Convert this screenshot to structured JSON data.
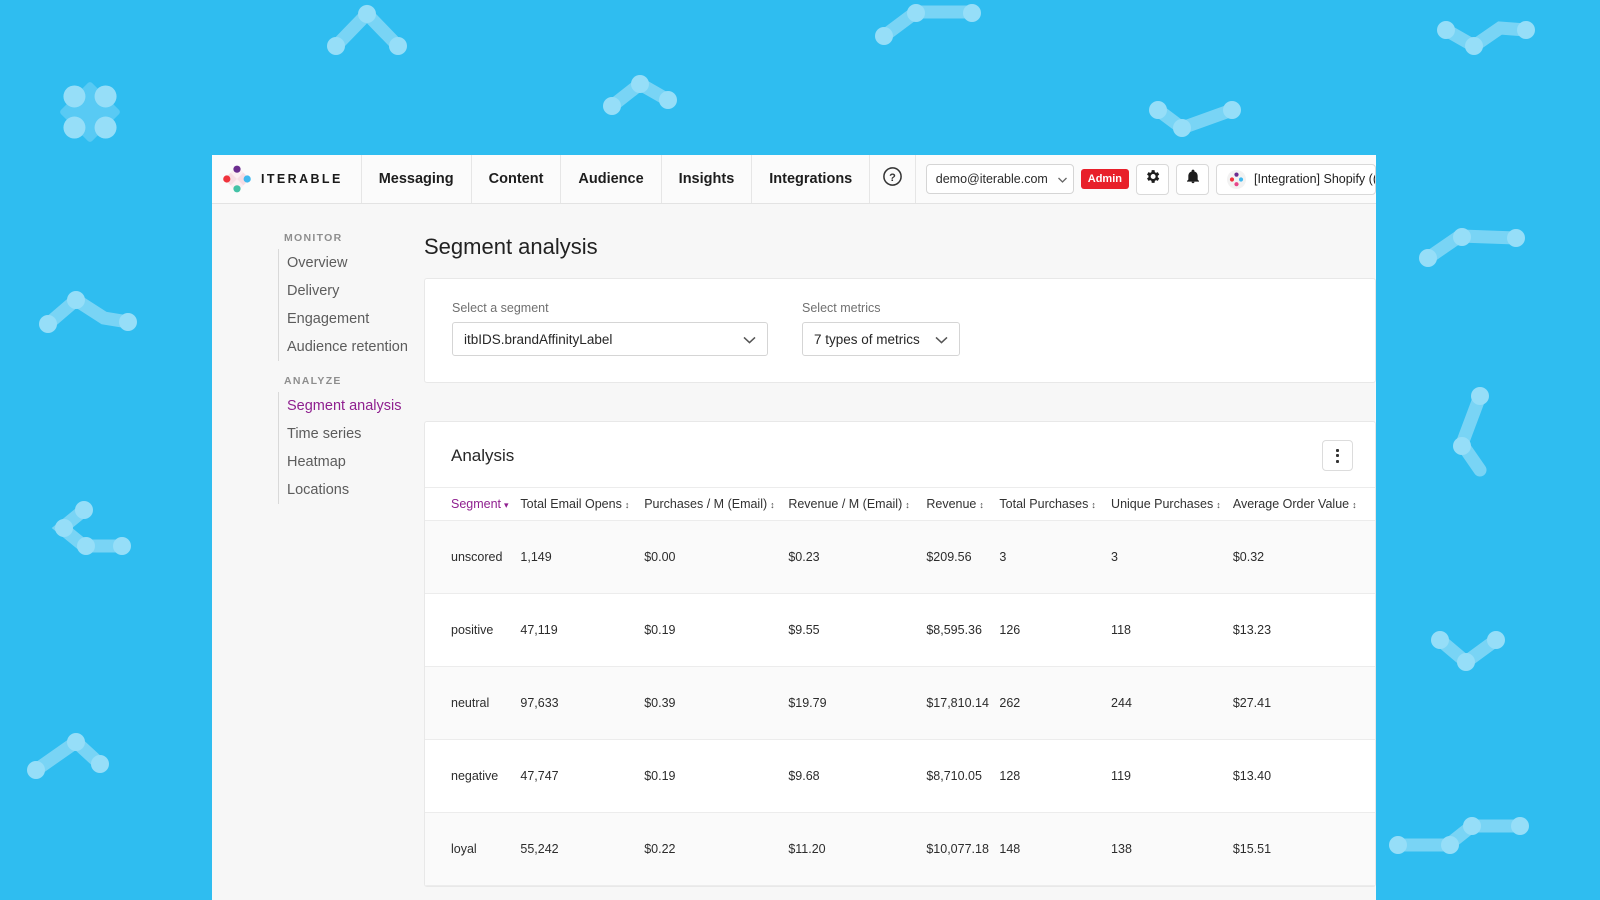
{
  "background": {
    "color": "#2fbdf0",
    "decor_color": "#87d9f7"
  },
  "topnav": {
    "brand": "ITERABLE",
    "brand_icon": "iterable-diamond-logo",
    "items": [
      {
        "label": "Messaging"
      },
      {
        "label": "Content"
      },
      {
        "label": "Audience"
      },
      {
        "label": "Insights"
      },
      {
        "label": "Integrations"
      }
    ],
    "help_icon": "question-circle-icon",
    "account": {
      "value": "demo@iterable.com",
      "caret_icon": "chevron-down-icon"
    },
    "admin_badge": "Admin",
    "admin_badge_color": "#e8202a",
    "gear_icon": "gear-icon",
    "bell_icon": "bell-icon",
    "integration": {
      "label": "[Integration] Shopify ((",
      "icon": "iterable-project-icon"
    }
  },
  "sidebar": {
    "groups": [
      {
        "label": "MONITOR",
        "items": [
          {
            "label": "Overview",
            "active": false
          },
          {
            "label": "Delivery",
            "active": false
          },
          {
            "label": "Engagement",
            "active": false
          },
          {
            "label": "Audience retention",
            "active": false
          }
        ]
      },
      {
        "label": "ANALYZE",
        "items": [
          {
            "label": "Segment analysis",
            "active": true
          },
          {
            "label": "Time series",
            "active": false
          },
          {
            "label": "Heatmap",
            "active": false
          },
          {
            "label": "Locations",
            "active": false
          }
        ]
      }
    ],
    "active_color": "#8f1f8f"
  },
  "page": {
    "title": "Segment analysis"
  },
  "filters": {
    "segment": {
      "label": "Select a segment",
      "value": "itbIDS.brandAffinityLabel",
      "caret_icon": "chevron-down-icon"
    },
    "metrics": {
      "label": "Select metrics",
      "value": "7 types of metrics",
      "caret_icon": "chevron-down-icon"
    }
  },
  "analysis": {
    "title": "Analysis",
    "menu_icon": "kebab-menu-icon",
    "chart_data": {
      "type": "table",
      "title": "Analysis",
      "columns": [
        {
          "label": "Segment",
          "sorted": true,
          "sort_icon": "caret-down"
        },
        {
          "label": "Total Email Opens",
          "sorted": false,
          "sort_icon": "sort-updown"
        },
        {
          "label": "Purchases / M (Email)",
          "sorted": false,
          "sort_icon": "sort-updown"
        },
        {
          "label": "Revenue / M (Email)",
          "sorted": false,
          "sort_icon": "sort-updown"
        },
        {
          "label": "Revenue",
          "sorted": false,
          "sort_icon": "sort-updown"
        },
        {
          "label": "Total Purchases",
          "sorted": false,
          "sort_icon": "sort-updown"
        },
        {
          "label": "Unique Purchases",
          "sorted": false,
          "sort_icon": "sort-updown"
        },
        {
          "label": "Average Order Value",
          "sorted": false,
          "sort_icon": "sort-updown"
        }
      ],
      "rows": [
        [
          "unscored",
          "1,149",
          "$0.00",
          "$0.23",
          "$209.56",
          "3",
          "3",
          "$0.32"
        ],
        [
          "positive",
          "47,119",
          "$0.19",
          "$9.55",
          "$8,595.36",
          "126",
          "118",
          "$13.23"
        ],
        [
          "neutral",
          "97,633",
          "$0.39",
          "$19.79",
          "$17,810.14",
          "262",
          "244",
          "$27.41"
        ],
        [
          "negative",
          "47,747",
          "$0.19",
          "$9.68",
          "$8,710.05",
          "128",
          "119",
          "$13.40"
        ],
        [
          "loyal",
          "55,242",
          "$0.22",
          "$11.20",
          "$10,077.18",
          "148",
          "138",
          "$15.51"
        ]
      ]
    }
  }
}
